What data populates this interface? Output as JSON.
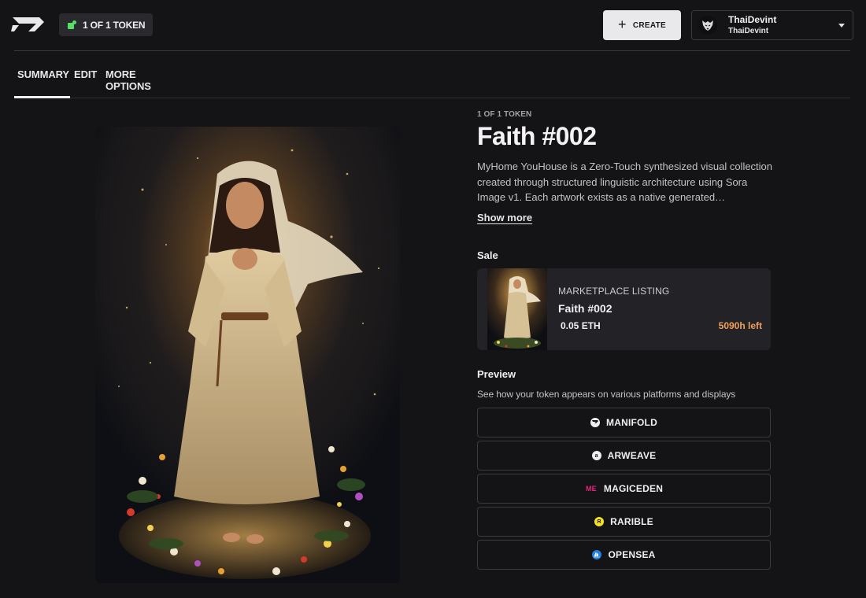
{
  "header": {
    "token_chip": "1 OF 1 TOKEN",
    "create_label": "CREATE",
    "account": {
      "name": "ThaiDevint",
      "handle": "ThaiDevint"
    }
  },
  "tabs": [
    {
      "label": "SUMMARY",
      "active": true
    },
    {
      "label": "EDIT",
      "active": false
    },
    {
      "label": "MORE OPTIONS",
      "active": false
    }
  ],
  "token": {
    "eyebrow": "1 OF 1 TOKEN",
    "title": "Faith #002",
    "description": "MyHome YouHouse is a Zero-Touch synthesized visual collection created through structured linguistic architecture using Sora Image v1. Each artwork exists as a native generated…",
    "show_more": "Show more"
  },
  "sale": {
    "section_label": "Sale",
    "kicker": "MARKETPLACE LISTING",
    "name": "Faith #002",
    "price": "0.05 ETH",
    "time_left": "5090h left"
  },
  "preview": {
    "section_label": "Preview",
    "subtitle": "See how your token appears on various platforms and displays",
    "platforms": [
      {
        "label": "MANIFOLD",
        "icon": "manifold-icon"
      },
      {
        "label": "ARWEAVE",
        "icon": "arweave-icon"
      },
      {
        "label": "MAGICEDEN",
        "icon": "magiceden-icon"
      },
      {
        "label": "RARIBLE",
        "icon": "rarible-icon"
      },
      {
        "label": "OPENSEA",
        "icon": "opensea-icon"
      }
    ]
  },
  "colors": {
    "background": "#141315",
    "accent_green": "#54e062",
    "time_orange": "#f0a05a"
  }
}
